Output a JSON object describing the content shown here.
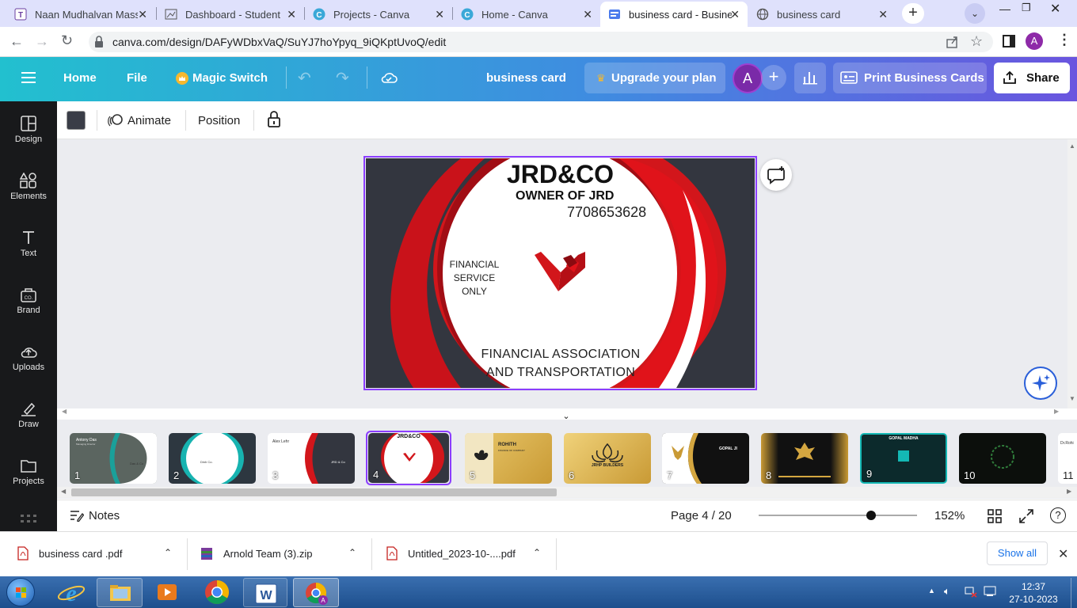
{
  "browser": {
    "tabs": [
      {
        "title": "Naan Mudhalvan Mass",
        "active": false
      },
      {
        "title": "Dashboard - Student",
        "active": false
      },
      {
        "title": "Projects - Canva",
        "active": false
      },
      {
        "title": "Home - Canva",
        "active": false
      },
      {
        "title": "business card - Busines",
        "active": true
      },
      {
        "title": "business card",
        "active": false
      }
    ],
    "url": "canva.com/design/DAFyWDbxVaQ/SuYJ7hoYpyq_9iQKptUvoQ/edit",
    "profile_initial": "A"
  },
  "header": {
    "home": "Home",
    "file": "File",
    "magic_switch": "Magic Switch",
    "design_title": "business card",
    "upgrade": "Upgrade your plan",
    "avatar_initial": "A",
    "print": "Print Business Cards",
    "share": "Share"
  },
  "sidebar": {
    "items": [
      {
        "label": "Design",
        "icon": "design-icon"
      },
      {
        "label": "Elements",
        "icon": "elements-icon"
      },
      {
        "label": "Text",
        "icon": "text-icon"
      },
      {
        "label": "Brand",
        "icon": "brand-icon"
      },
      {
        "label": "Uploads",
        "icon": "uploads-icon"
      },
      {
        "label": "Draw",
        "icon": "draw-icon"
      },
      {
        "label": "Projects",
        "icon": "projects-icon"
      }
    ]
  },
  "toolbar": {
    "color_swatch": "#3a3d47",
    "animate": "Animate",
    "position": "Position"
  },
  "card": {
    "company": "JRD&CO",
    "owner": "OWNER OF JRD",
    "phone": "7708653628",
    "service_line1": "FINANCIAL",
    "service_line2": "SERVICE",
    "service_line3": "ONLY",
    "tagline_line1": "FINANCIAL ASSOCIATION",
    "tagline_line2": "AND TRANSPORTATION",
    "colors": {
      "background": "#33363f",
      "accent": "#d2161b",
      "center": "#ffffff"
    }
  },
  "pages": {
    "thumbnails": [
      {
        "num": "1"
      },
      {
        "num": "2"
      },
      {
        "num": "3"
      },
      {
        "num": "4"
      },
      {
        "num": "5"
      },
      {
        "num": "6"
      },
      {
        "num": "7"
      },
      {
        "num": "8"
      },
      {
        "num": "9"
      },
      {
        "num": "10"
      },
      {
        "num": "11"
      }
    ],
    "thumb_text": {
      "t1_name": "Antony Das",
      "t1_role": "Managing Director",
      "t1_brand": "Das & Co",
      "t2_brand": "Dinh Co.",
      "t3_name": "Alex Lehr",
      "t3_brand": "JRD & Co",
      "t4_company": "JRD&CO",
      "t5_name": "ROHITH",
      "t5_sub": "FINANCE OF COMPANY",
      "t6_brand": "JRHP BUILDERS",
      "t7_name": "GOPAL JI",
      "t9_name": "GOPAL MADHA",
      "t11_name": "Dr.Rohi"
    }
  },
  "bottombar": {
    "notes": "Notes",
    "page_indicator": "Page 4 / 20",
    "zoom": "152%",
    "zoom_level": 0.71
  },
  "downloads": {
    "items": [
      {
        "name": "business card .pdf"
      },
      {
        "name": "Arnold Team (3).zip"
      },
      {
        "name": "Untitled_2023-10-....pdf"
      }
    ],
    "show_all": "Show all"
  },
  "taskbar": {
    "time": "12:37",
    "date": "27-10-2023"
  }
}
